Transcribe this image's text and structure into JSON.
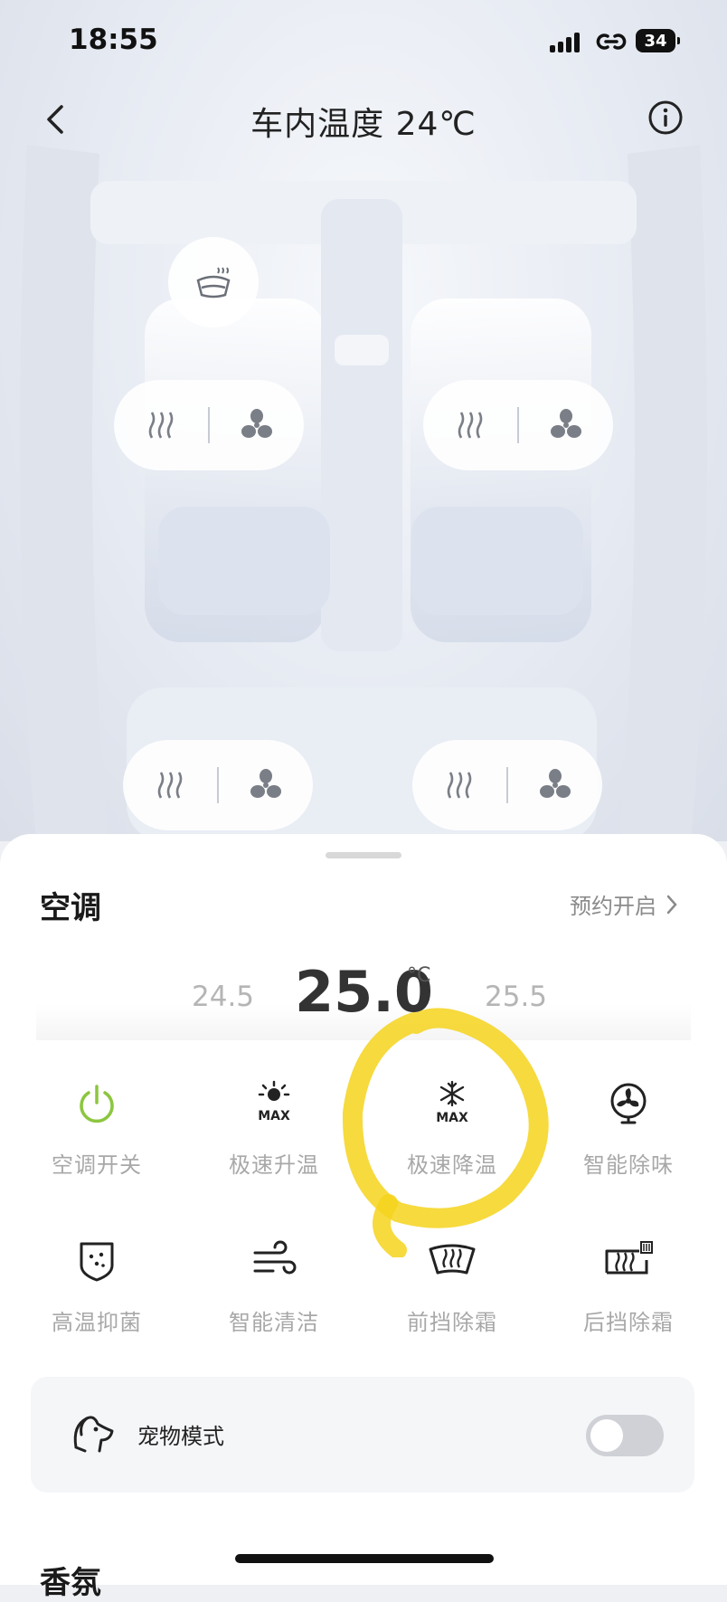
{
  "status_bar": {
    "time": "18:55",
    "battery": "34"
  },
  "header": {
    "title": "车内温度 24℃"
  },
  "ac": {
    "section_title": "空调",
    "reserve_label": "预约开启",
    "temp_prev": "24.5",
    "temp_current": "25.0",
    "temp_unit": "°C",
    "temp_next": "25.5"
  },
  "controls": [
    {
      "label": "空调开关",
      "icon": "power-icon"
    },
    {
      "label": "极速升温",
      "icon": "sun-max-icon"
    },
    {
      "label": "极速降温",
      "icon": "snow-max-icon"
    },
    {
      "label": "智能除味",
      "icon": "fan-icon"
    },
    {
      "label": "高温抑菌",
      "icon": "shield-icon"
    },
    {
      "label": "智能清洁",
      "icon": "wind-icon"
    },
    {
      "label": "前挡除霜",
      "icon": "front-defrost-icon"
    },
    {
      "label": "后挡除霜",
      "icon": "rear-defrost-icon"
    }
  ],
  "pet_mode": {
    "label": "宠物模式",
    "enabled": false
  },
  "next_section_title": "香氛",
  "colors": {
    "power_green": "#8cc63f",
    "highlight_yellow": "#f5d31c"
  }
}
